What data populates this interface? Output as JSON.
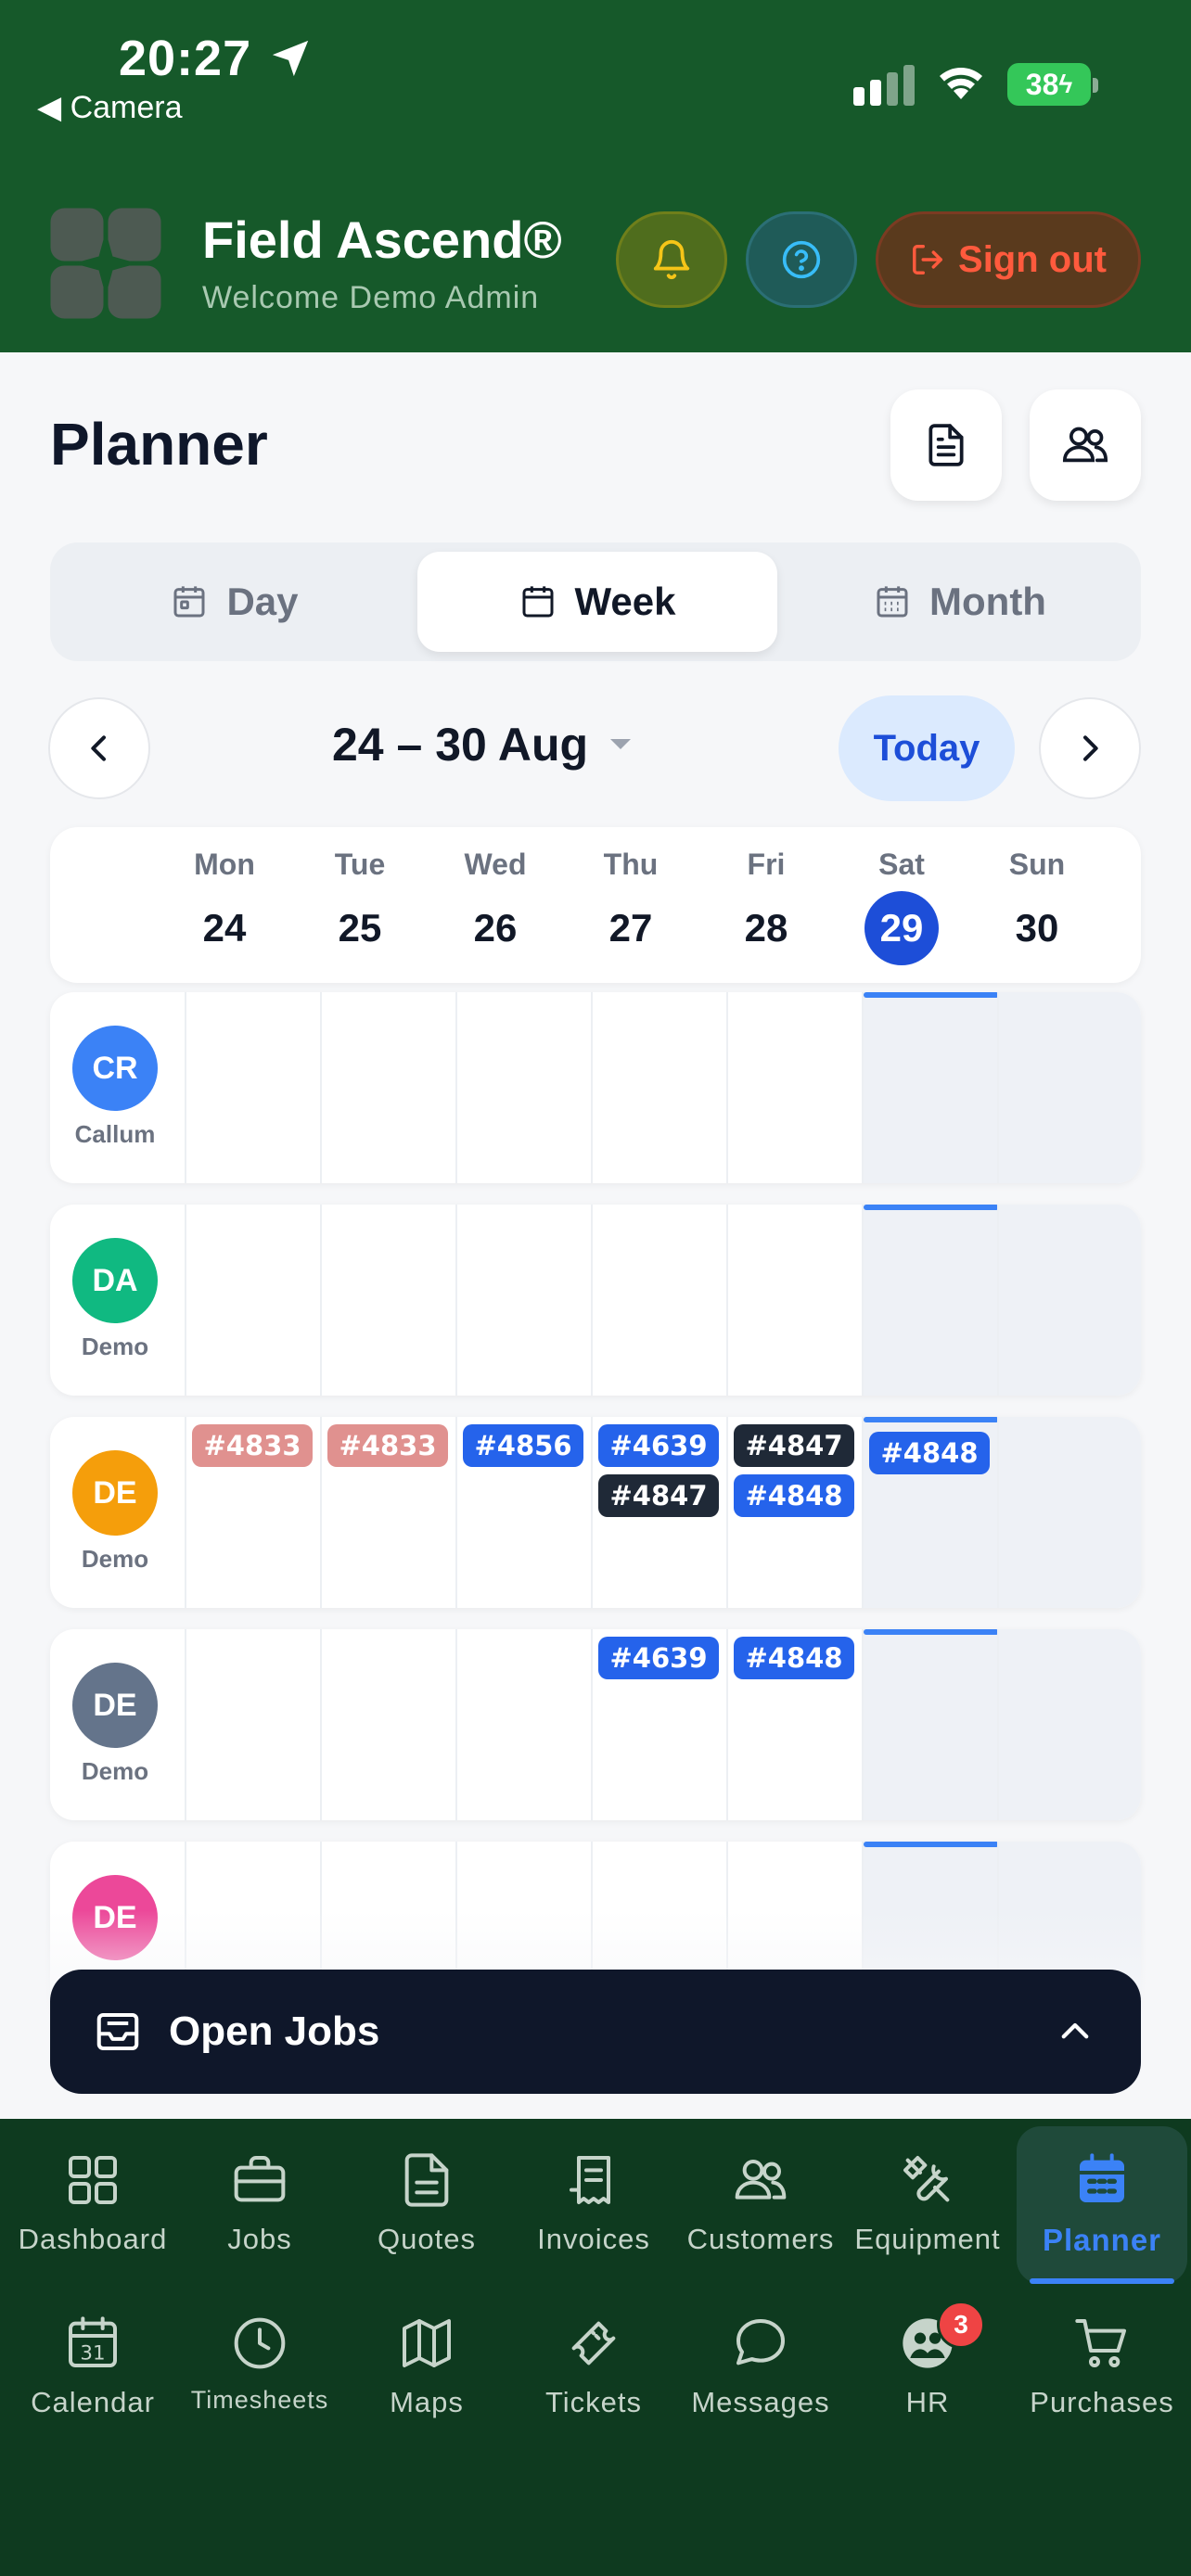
{
  "status_bar": {
    "time": "20:27",
    "back_label": "◀ Camera",
    "battery": "38"
  },
  "header": {
    "brand": "Field Ascend®",
    "welcome": "Welcome Demo Admin",
    "sign_out_label": "Sign out",
    "colors": {
      "bar": "#16592a",
      "sign_out": "#ff5a3d"
    }
  },
  "planner": {
    "title": "Planner",
    "views": {
      "day": "Day",
      "week": "Week",
      "month": "Month",
      "selected": "Week"
    },
    "range_label": "24 – 30 Aug",
    "today_label": "Today",
    "days": [
      {
        "name": "Mon",
        "num": "24"
      },
      {
        "name": "Tue",
        "num": "25"
      },
      {
        "name": "Wed",
        "num": "26"
      },
      {
        "name": "Thu",
        "num": "27"
      },
      {
        "name": "Fri",
        "num": "28"
      },
      {
        "name": "Sat",
        "num": "29",
        "today": true
      },
      {
        "name": "Sun",
        "num": "30"
      }
    ],
    "rows": [
      {
        "initials": "CR",
        "name": "Callum",
        "color": "#3b82f6",
        "jobs": []
      },
      {
        "initials": "DA",
        "name": "Demo",
        "color": "#10b981",
        "jobs": []
      },
      {
        "initials": "DE",
        "name": "Demo",
        "color": "#f59e0b",
        "jobs": [
          {
            "day": 0,
            "slot": 0,
            "label": "#4833",
            "style": "pink"
          },
          {
            "day": 1,
            "slot": 0,
            "label": "#4833",
            "style": "pink"
          },
          {
            "day": 2,
            "slot": 0,
            "label": "#4856",
            "style": "blue"
          },
          {
            "day": 3,
            "slot": 0,
            "label": "#4639",
            "style": "blue"
          },
          {
            "day": 3,
            "slot": 1,
            "label": "#4847",
            "style": "dark"
          },
          {
            "day": 4,
            "slot": 0,
            "label": "#4847",
            "style": "dark"
          },
          {
            "day": 4,
            "slot": 1,
            "label": "#4848",
            "style": "blue"
          },
          {
            "day": 5,
            "slot": 0,
            "label": "#4848",
            "style": "blue"
          }
        ]
      },
      {
        "initials": "DE",
        "name": "Demo",
        "color": "#64748b",
        "jobs": [
          {
            "day": 3,
            "slot": 0,
            "label": "#4639",
            "style": "blue"
          },
          {
            "day": 4,
            "slot": 0,
            "label": "#4848",
            "style": "blue"
          }
        ]
      },
      {
        "initials": "DE",
        "name": "",
        "color": "#ec4899",
        "jobs": []
      }
    ],
    "open_jobs_label": "Open Jobs"
  },
  "bottom_nav": {
    "row1": [
      {
        "label": "Dashboard",
        "icon": "grid-icon"
      },
      {
        "label": "Jobs",
        "icon": "briefcase-icon"
      },
      {
        "label": "Quotes",
        "icon": "document-icon"
      },
      {
        "label": "Invoices",
        "icon": "receipt-icon"
      },
      {
        "label": "Customers",
        "icon": "users-icon"
      },
      {
        "label": "Equipment",
        "icon": "tools-icon"
      },
      {
        "label": "Planner",
        "icon": "calendar-grid-icon",
        "active": true
      }
    ],
    "row2": [
      {
        "label": "Calendar",
        "icon": "calendar-31-icon"
      },
      {
        "label": "Timesheets",
        "icon": "clock-icon"
      },
      {
        "label": "Maps",
        "icon": "map-icon"
      },
      {
        "label": "Tickets",
        "icon": "ticket-icon"
      },
      {
        "label": "Messages",
        "icon": "chat-icon"
      },
      {
        "label": "HR",
        "icon": "hr-people-icon",
        "badge": "3"
      },
      {
        "label": "Purchases",
        "icon": "cart-icon"
      }
    ]
  }
}
